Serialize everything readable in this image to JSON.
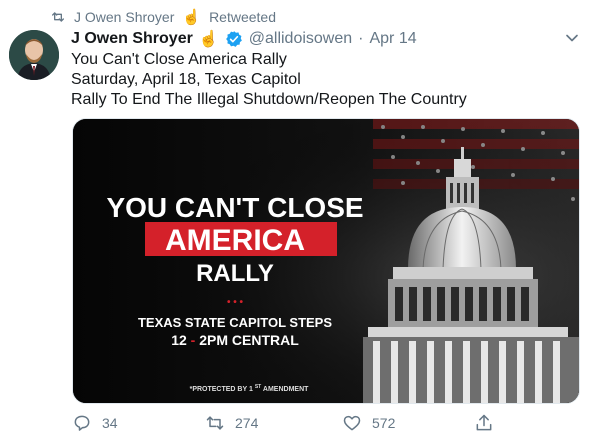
{
  "retweet": {
    "by": "J Owen Shroyer",
    "label": "Retweeted",
    "icon": "retweet-icon"
  },
  "tweet": {
    "author": "J Owen Shroyer",
    "handle": "@allidoisowen",
    "separator": "·",
    "date": "Apr 14",
    "lines": [
      "You Can't Close America Rally",
      "Saturday, April 18, Texas Capitol",
      "Rally To End The Illegal Shutdown/Reopen The Country"
    ]
  },
  "media": {
    "headline_1": "YOU CAN'T CLOSE",
    "headline_2": "AMERICA",
    "headline_3": "RALLY",
    "dots": "• • •",
    "location": "TEXAS STATE CAPITOL STEPS",
    "time_start": "12",
    "time_sep": "-",
    "time_end": "2PM CENTRAL",
    "footnote_pre": "*PROTECTED BY 1",
    "footnote_sup": "ST",
    "footnote_post": " AMENDMENT"
  },
  "actions": {
    "replies": "34",
    "retweets": "274",
    "likes": "572"
  },
  "colors": {
    "muted": "#657786",
    "verified": "#1da1f2",
    "accent_red": "#d4212a",
    "emoji": "#f0b429"
  }
}
